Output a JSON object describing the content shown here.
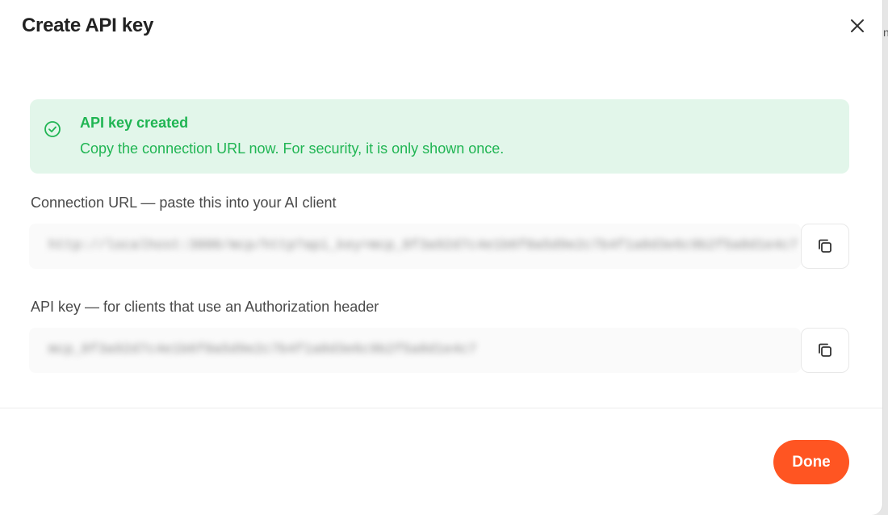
{
  "dialog": {
    "title": "Create API key",
    "edge_char": "n"
  },
  "icons": {
    "close": "close-icon",
    "success": "check-circle-icon",
    "copy": "copy-icon"
  },
  "alert": {
    "title": "API key created",
    "message": "Copy the connection URL now. For security, it is only shown once."
  },
  "connection_url": {
    "label": "Connection URL — paste this into your AI client",
    "value": "http://localhost:3000/mcp/http?api_key=mcp_8f3a92d7c4e1b6f0a5d9e2c7b4f1a8d3e6c9b2f5a8d1e4c7"
  },
  "api_key": {
    "label": "API key — for clients that use an Authorization header",
    "value": "mcp_8f3a92d7c4e1b6f0a5d9e2c7b4f1a8d3e6c9b2f5a8d1e4c7"
  },
  "footer": {
    "done_label": "Done"
  },
  "colors": {
    "accent": "#ff5522",
    "success_text": "#20b553",
    "success_bg": "#e2f6ea"
  }
}
